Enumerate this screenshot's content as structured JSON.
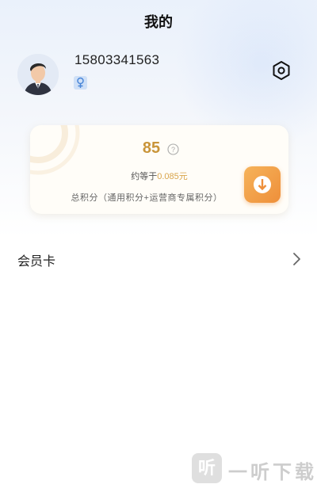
{
  "header": {
    "title": "我的"
  },
  "profile": {
    "phone": "15803341563",
    "gender_icon": "female-gender-icon",
    "settings_icon": "settings-icon"
  },
  "points_card": {
    "points": "85",
    "help_icon": "question-circle-icon",
    "approx_prefix": "约等于",
    "approx_value": "0.085元",
    "total_label": "总积分（通用积分+运营商专属积分）",
    "download_icon": "download-icon",
    "accent_color": "#c9953a"
  },
  "menu": {
    "member_card_label": "会员卡",
    "chevron_icon": "chevron-right-icon"
  },
  "watermark": {
    "logo_char": "听",
    "text": "一听下载"
  }
}
